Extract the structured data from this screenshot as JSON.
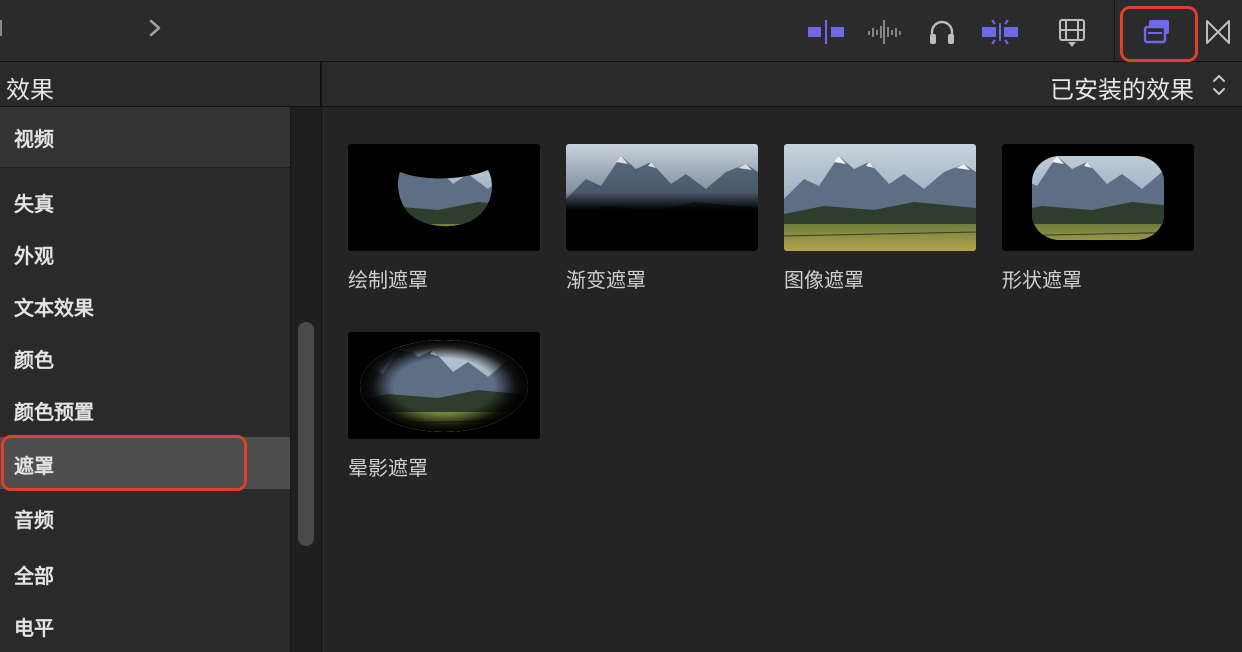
{
  "toolbar": {
    "icons": [
      "clip-position-icon",
      "audio-waveform-icon",
      "headphones-icon",
      "snapping-icon",
      "film-strip-icon",
      "effects-browser-icon",
      "transitions-icon"
    ],
    "active_color": "#6f69e8",
    "highlight_color": "#e0402a"
  },
  "left_header": {
    "title": "效果"
  },
  "right_header": {
    "title": "已安装的效果"
  },
  "sidebar": {
    "group": "视频",
    "items": [
      "失真",
      "外观",
      "文本效果",
      "颜色",
      "颜色预置",
      "遮罩",
      "音频",
      "全部",
      "电平"
    ],
    "selected": "遮罩"
  },
  "effects": [
    {
      "label": "绘制遮罩"
    },
    {
      "label": "渐变遮罩"
    },
    {
      "label": "图像遮罩"
    },
    {
      "label": "形状遮罩"
    },
    {
      "label": "晕影遮罩"
    }
  ]
}
